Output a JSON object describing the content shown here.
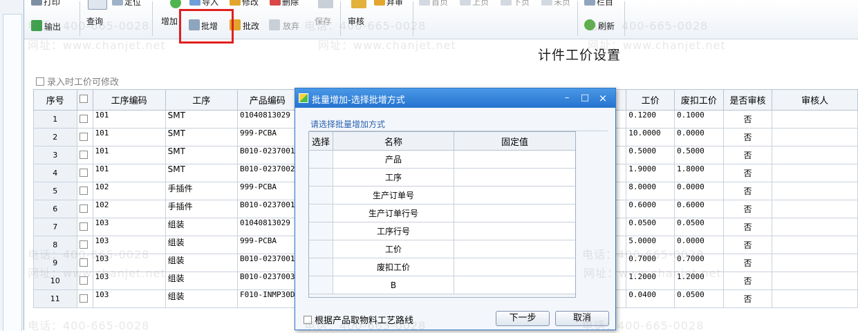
{
  "toolbar": {
    "print": "打印",
    "export": "输出",
    "query": "查询",
    "locate": "定位",
    "add": "增加",
    "import": "导入",
    "modify": "修改",
    "delete": "删除",
    "batch_add": "批增",
    "batch_modify": "批改",
    "discard": "放弃",
    "save": "保存",
    "audit": "审核",
    "unaudit": "弃审",
    "first": "首页",
    "prev": "上页",
    "next": "下页",
    "last": "末页",
    "columns": "栏目",
    "refresh": "刷新"
  },
  "page": {
    "title": "计件工价设置",
    "editable_checkbox": "录入时工价可修改"
  },
  "grid": {
    "headers": [
      "序号",
      "",
      "工序编码",
      "工序",
      "产品编码",
      "工价",
      "废扣工价",
      "是否审核",
      "审核人"
    ],
    "rows": [
      {
        "seq": "1",
        "code": "101",
        "proc": "SMT",
        "prod": "01040813029",
        "price": "0.1200",
        "scrap": "0.1000",
        "audit": "否"
      },
      {
        "seq": "2",
        "code": "101",
        "proc": "SMT",
        "prod": "999-PCBA",
        "price": "10.0000",
        "scrap": "0.0000",
        "audit": "否"
      },
      {
        "seq": "3",
        "code": "101",
        "proc": "SMT",
        "prod": "B010-0237001",
        "price": "0.5000",
        "scrap": "0.5000",
        "audit": "否"
      },
      {
        "seq": "4",
        "code": "101",
        "proc": "SMT",
        "prod": "B010-0237002",
        "price": "1.9000",
        "scrap": "1.8000",
        "audit": "否"
      },
      {
        "seq": "5",
        "code": "102",
        "proc": "手插件",
        "prod": "999-PCBA",
        "price": "8.0000",
        "scrap": "0.0000",
        "audit": "否"
      },
      {
        "seq": "6",
        "code": "102",
        "proc": "手插件",
        "prod": "B010-0237001",
        "price": "0.6000",
        "scrap": "0.6000",
        "audit": "否"
      },
      {
        "seq": "7",
        "code": "103",
        "proc": "组装",
        "prod": "01040813029",
        "price": "0.0500",
        "scrap": "0.0500",
        "audit": "否"
      },
      {
        "seq": "8",
        "code": "103",
        "proc": "组装",
        "prod": "999-PCBA",
        "price": "5.0000",
        "scrap": "0.0000",
        "audit": "否"
      },
      {
        "seq": "9",
        "code": "103",
        "proc": "组装",
        "prod": "B010-0237001",
        "price": "0.7000",
        "scrap": "0.7000",
        "audit": "否"
      },
      {
        "seq": "10",
        "code": "103",
        "proc": "组装",
        "prod": "B010-0237003",
        "price": "1.2000",
        "scrap": "1.2000",
        "audit": "否"
      },
      {
        "seq": "11",
        "code": "103",
        "proc": "组装",
        "prod": "F010-INMP30D",
        "price": "0.0400",
        "scrap": "0.0500",
        "audit": "否"
      }
    ]
  },
  "dialog": {
    "title": "批量增加-选择批增方式",
    "minimize": "–",
    "maximize": "□",
    "close": "×",
    "group_label": "请选择批量增加方式",
    "headers": [
      "选择",
      "名称",
      "固定值"
    ],
    "options": [
      "产品",
      "工序",
      "生产订单号",
      "生产订单行号",
      "工序行号",
      "工价",
      "废扣工价",
      "B"
    ],
    "route_checkbox": "根据产品取物料工艺路线",
    "next_button": "下一步",
    "cancel_button": "取消"
  },
  "watermark": {
    "phone": "电话：400-665-0028",
    "url": "网址：www.chanjet.net"
  },
  "colors": {
    "highlight": "#e02020",
    "dialog_title": "#2f78c8",
    "group_label": "#2a62b0"
  }
}
